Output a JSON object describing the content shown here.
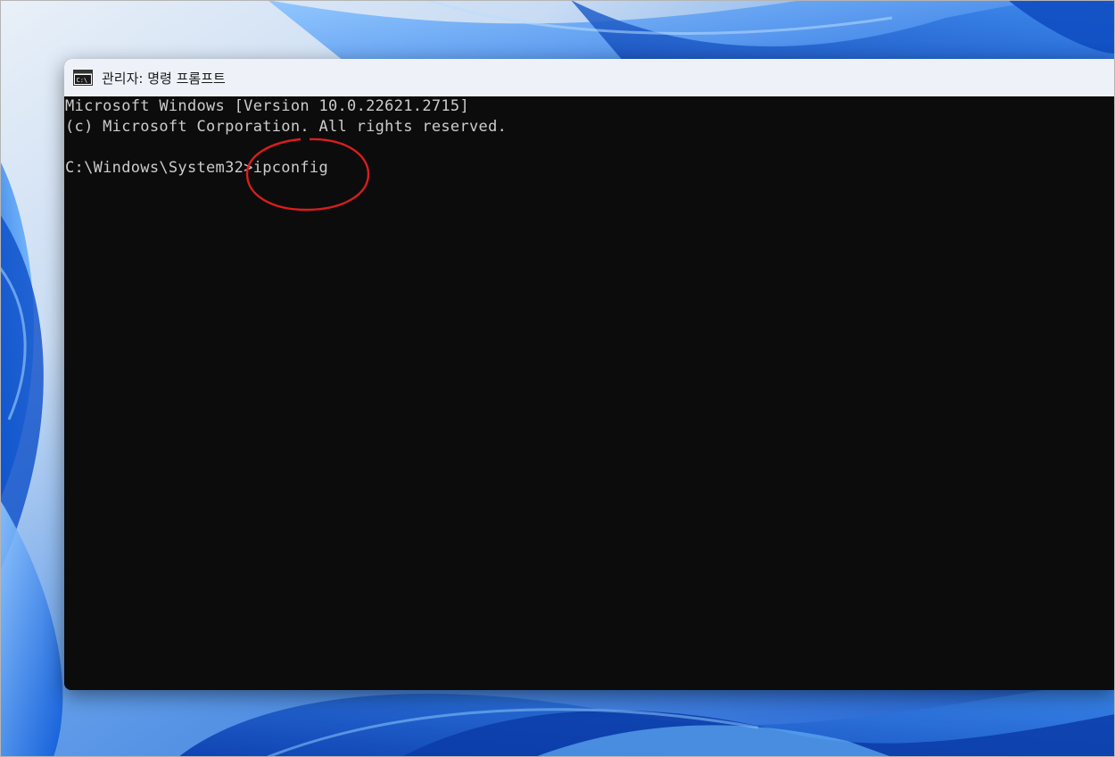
{
  "window": {
    "title": "관리자: 명령 프롬프트",
    "icon": "cmd-icon"
  },
  "console": {
    "lines": [
      "Microsoft Windows [Version 10.0.22621.2715]",
      "(c) Microsoft Corporation. All rights reserved.",
      ""
    ],
    "prompt": "C:\\Windows\\System32>",
    "input": "ipconfig"
  },
  "colors": {
    "console_bg": "#0c0c0c",
    "console_text": "#cccccc",
    "titlebar_bg": "#eef2f8",
    "annotation": "#d81e1e",
    "desktop_accent": "#1a5fd6"
  }
}
